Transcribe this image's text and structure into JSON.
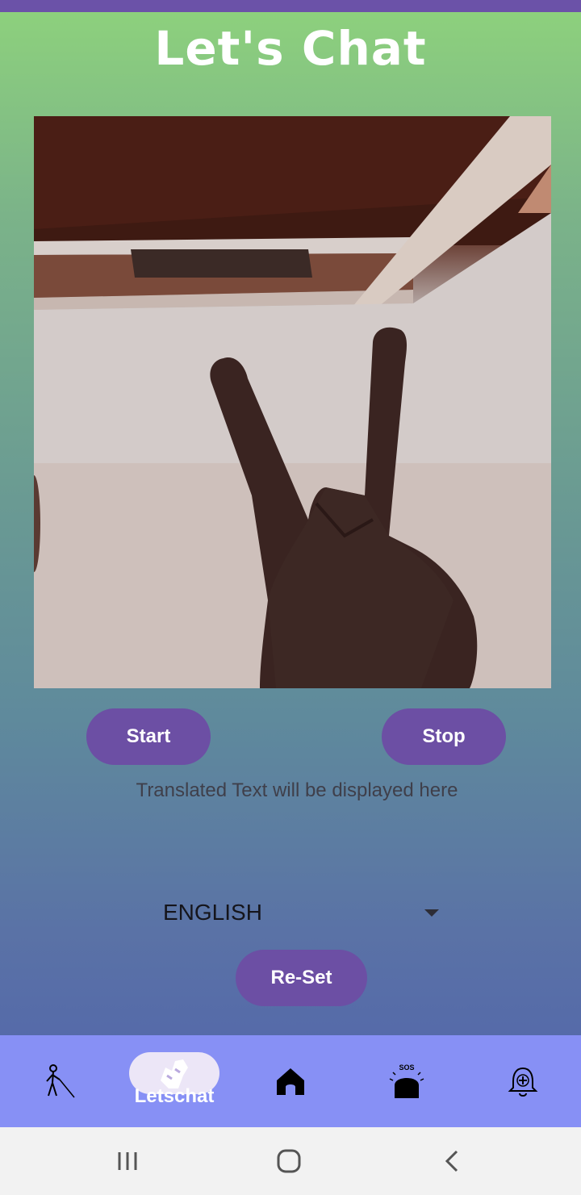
{
  "header": {
    "title": "Let's Chat"
  },
  "controls": {
    "start_label": "Start",
    "stop_label": "Stop",
    "reset_label": "Re-Set"
  },
  "output": {
    "translated_text": "Translated Text will be displayed here"
  },
  "language": {
    "selected": "ENGLISH"
  },
  "bottom_nav": {
    "items": [
      {
        "icon": "blind-person-icon"
      },
      {
        "icon": "letschat-icon",
        "label": "Letschat"
      },
      {
        "icon": "home-icon"
      },
      {
        "icon": "sos-alarm-icon"
      },
      {
        "icon": "medical-bell-icon"
      }
    ]
  },
  "system_nav": [
    "recent-apps-icon",
    "home-circle-icon",
    "back-icon"
  ]
}
